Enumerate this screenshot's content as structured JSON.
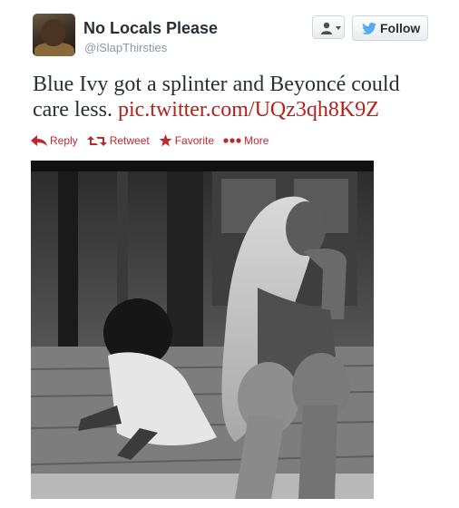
{
  "user": {
    "display_name": "No Locals Please",
    "handle": "@iSlapThirsties",
    "avatar_icon": "profile-photo"
  },
  "buttons": {
    "user_menu_icon": "user-dropdown-icon",
    "follow_label": "Follow"
  },
  "tweet": {
    "text": "Blue Ivy got a splinter and Beyoncé could care less.",
    "link": "pic.twitter.com/UQz3qh8K9Z"
  },
  "actions": [
    {
      "label": "Reply",
      "icon": "reply-icon"
    },
    {
      "label": "Retweet",
      "icon": "retweet-icon"
    },
    {
      "label": "Favorite",
      "icon": "star-icon"
    },
    {
      "label": "More",
      "icon": "more-dots-icon"
    }
  ],
  "colors": {
    "accent": "#c0262c",
    "link": "#b0221e",
    "text": "#292f33",
    "muted": "#8899a6",
    "twitter_blue": "#55acee"
  }
}
